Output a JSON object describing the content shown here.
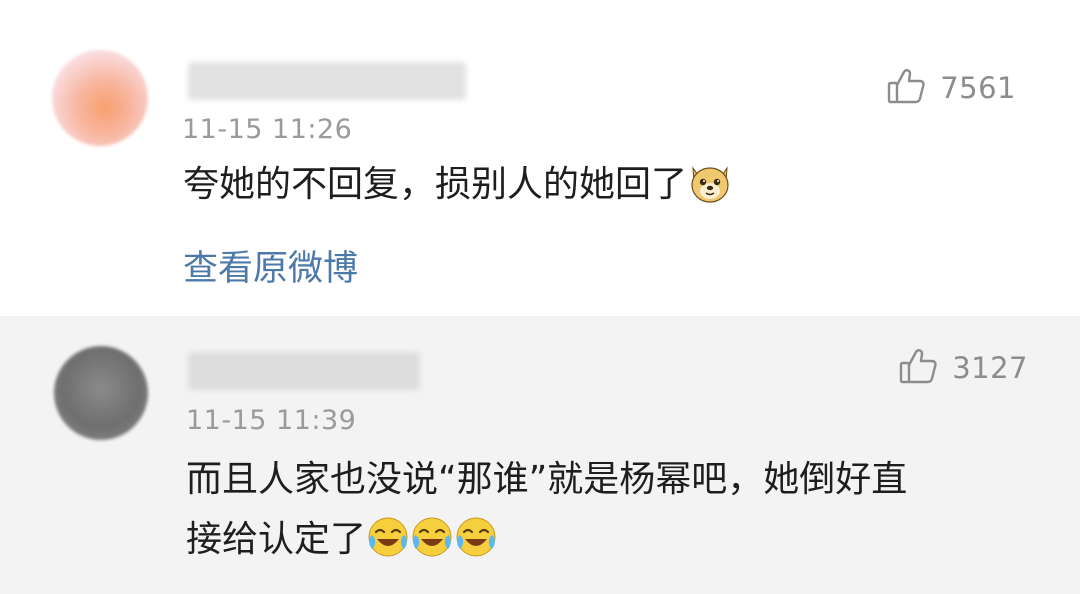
{
  "comments": [
    {
      "time": "11-15 11:26",
      "likes": "7561",
      "text": "夸她的不回复，损别人的她回了",
      "emojis": [
        "doge-emoji"
      ],
      "link": "查看原微博"
    },
    {
      "time": "11-15 11:39",
      "likes": "3127",
      "text_line1": "而且人家也没说“那谁”就是杨幂吧，她倒好直",
      "text_line2": "接给认定了",
      "emojis": [
        "laugh-cry-emoji",
        "laugh-cry-emoji",
        "laugh-cry-emoji"
      ]
    }
  ],
  "colors": {
    "link": "#4c79a9",
    "meta": "#9a9a9a",
    "highlight_bg": "#f3f3f3"
  },
  "icons": [
    "thumbs-up-icon"
  ]
}
